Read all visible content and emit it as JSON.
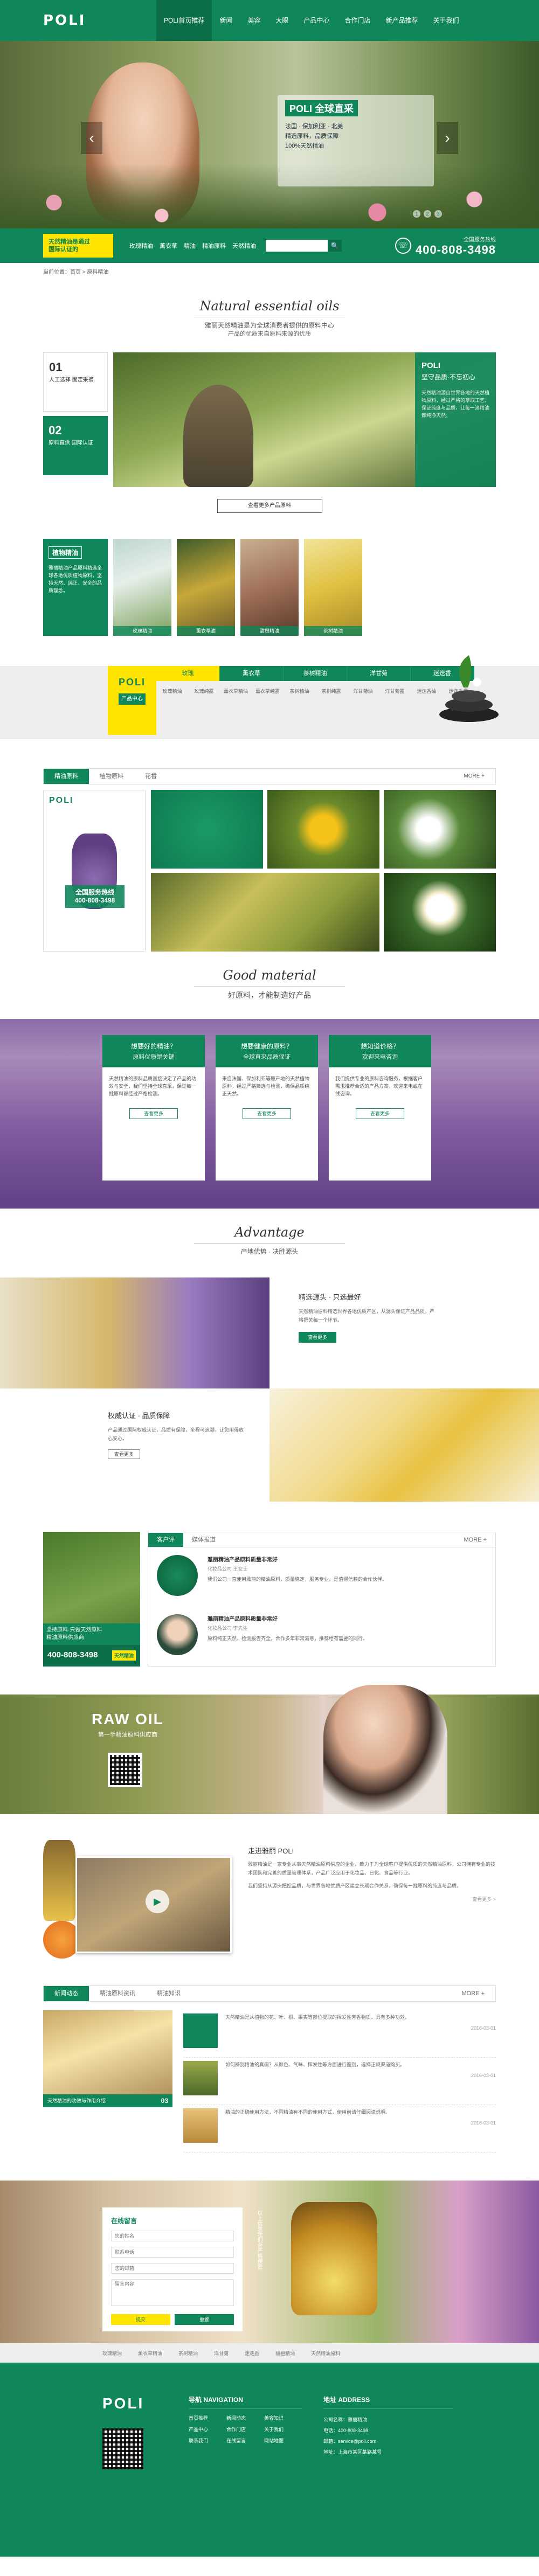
{
  "nav": {
    "logo": "POLI",
    "items": [
      "POLI首页推荐",
      "新闻",
      "美容",
      "大眼",
      "产品中心",
      "合作门店",
      "新产品推荐",
      "关于我们"
    ]
  },
  "hero": {
    "brand": "POLI 全球直采",
    "lines": [
      "法国 · 保加利亚 · 北美",
      "精选原料，品质保障",
      "100%天然精油"
    ],
    "arrow_left": "‹",
    "arrow_right": "›",
    "dots": [
      "1",
      "2",
      "3"
    ]
  },
  "search": {
    "badge": "天然精油是通过",
    "badge2": "国际认证的",
    "hot": [
      "玫瑰精油",
      "薰衣草",
      "精油",
      "精油原料",
      "天然精油"
    ],
    "placeholder": "",
    "button": "🔍",
    "phone_label": "全国服务热线",
    "phone": "400-808-3498"
  },
  "crumb": "当前位置：首页 > 原料精油",
  "s1": {
    "script": "Natural essential oils",
    "sub": "雅丽天然精油是为全球消费者提供的原料中心",
    "desc": "产品的优质来自原料来源的优质",
    "box1_num": "01",
    "box1_text": "人工选择 固定采摘",
    "box2_num": "02",
    "box2_text": "原料直供 国际认证",
    "gcard_title": "POLI",
    "gcard_title2": "坚守品质·不忘初心",
    "gcard_desc": "天然精油源自世界各地的天然植物原料，经过严格的萃取工艺，保证纯度与品质，让每一滴精油都纯净天然。",
    "btn": "查看更多产品原料",
    "row2_title": "植物精油",
    "row2_desc": "雅丽精油产品原料精选全球各地优质植物原料，坚持天然、纯正、安全的品质理念。",
    "labels": [
      "玫瑰精油",
      "薰衣草油",
      "甜橙精油",
      "茶树精油"
    ]
  },
  "cat": {
    "logo": "POLI",
    "logo_sub": "产品中心",
    "cols": [
      {
        "h": "玫瑰",
        "items": [
          "玫瑰精油",
          "玫瑰纯露"
        ]
      },
      {
        "h": "薰衣草",
        "items": [
          "薰衣草精油",
          "薰衣草纯露"
        ]
      },
      {
        "h": "茶树精油",
        "items": [
          "茶树精油",
          "茶树纯露"
        ]
      },
      {
        "h": "洋甘菊",
        "items": [
          "洋甘菊油",
          "洋甘菊露"
        ]
      },
      {
        "h": "迷迭香",
        "items": [
          "迷迭香油",
          "迷迭香露"
        ]
      }
    ]
  },
  "gallery": {
    "tabs": [
      "精油原料",
      "植物原料",
      "花香"
    ],
    "more": "MORE +",
    "tag": "全国服务热线\n400-808-3498",
    "logo": "POLI"
  },
  "good": {
    "script": "Good material",
    "sub": "好原料，才能制造好产品",
    "cards": [
      {
        "h": "想要好的精油？",
        "q": "原料优质是关键",
        "p": "天然精油的原料品质直接决定了产品的功效与安全，我们坚持全球直采，保证每一批原料都经过严格检测。",
        "btn": "查看更多"
      },
      {
        "h": "想要健康的原料？",
        "q": "全球直采品质保证",
        "p": "来自法国、保加利亚等原产地的天然植物原料，经过严格筛选与检测，确保品质纯正天然。",
        "btn": "查看更多"
      },
      {
        "h": "想知道价格？",
        "q": "欢迎来电咨询",
        "p": "我们提供专业的原料咨询服务，根据客户需求推荐合适的产品方案，欢迎来电或在线咨询。",
        "btn": "查看更多"
      }
    ]
  },
  "adv": {
    "script": "Advantage",
    "sub": "产地优势 · 决胜源头",
    "b1_h": "精选源头 · 只选最好",
    "b1_p": "天然精油原料精选世界各地优质产区，从源头保证产品品质，严格把关每一个环节。",
    "b1_btn": "查看更多",
    "b2_h": "权威认证 · 品质保障",
    "b2_p": "产品通过国际权威认证，品质有保障，全程可追溯，让您用得放心安心。",
    "b2_btn": "查看更多"
  },
  "test": {
    "tabs": [
      "客户评",
      "媒体报道"
    ],
    "more": "MORE +",
    "left_text": "坚持原料·只做天然原料\n精油原料供应商",
    "left_phone": "400-808-3498",
    "left_badge": "天然精油",
    "items": [
      {
        "t": "雅丽精油产品原料质量非常好",
        "s": "化妆品公司 王女士",
        "p": "我们公司一直使用雅丽的精油原料，质量稳定，服务专业，是值得信赖的合作伙伴。"
      },
      {
        "t": "雅丽精油产品原料质量非常好",
        "s": "化妆品公司 李先生",
        "p": "原料纯正天然，检测报告齐全，合作多年非常满意，推荐给有需要的同行。"
      }
    ]
  },
  "raw": {
    "a": "RAW OIL",
    "b": "第一手精油原料供应商"
  },
  "about": {
    "h": "走进雅丽 POLI",
    "p1": "雅丽精油是一家专业从事天然精油原料供应的企业，致力于为全球客户提供优质的天然精油原料。公司拥有专业的技术团队和完善的质量管理体系，产品广泛应用于化妆品、日化、食品等行业。",
    "p2": "我们坚持从源头把控品质，与世界各地优质产区建立长期合作关系，确保每一批原料的纯度与品质。",
    "more": "查看更多 >"
  },
  "news": {
    "tabs": [
      "新闻动态",
      "精油原料资讯",
      "精油知识"
    ],
    "more": "MORE +",
    "feat": "天然精油的功效与作用介绍",
    "feat_date": "03",
    "items": [
      {
        "p": "天然精油是从植物的花、叶、根、果实等部位提取的挥发性芳香物质，具有多种功效。",
        "d": "2016-03-01"
      },
      {
        "p": "如何辨别精油的真假？从颜色、气味、挥发性等方面进行鉴别，选择正规渠道购买。",
        "d": "2016-03-01"
      },
      {
        "p": "精油的正确使用方法，不同精油有不同的使用方式，使用前请仔细阅读说明。",
        "d": "2016-03-01"
      }
    ]
  },
  "form": {
    "h": "在线留言",
    "fields": [
      "您的姓名",
      "联系电话",
      "您的邮箱",
      "留言内容"
    ],
    "btn1": "提交",
    "btn2": "重置",
    "note": "以上信息我们会严格保密"
  },
  "links": [
    "玫瑰精油",
    "薰衣草精油",
    "茶树精油",
    "洋甘菊",
    "迷迭香",
    "甜橙精油",
    "天然精油原料"
  ],
  "footer": {
    "logo": "POLI",
    "nav_h": "导航 NAVIGATION",
    "nav": [
      "首页推荐",
      "新闻动态",
      "美容知识",
      "产品中心",
      "合作门店",
      "关于我们",
      "联系我们",
      "在线留言",
      "网站地图"
    ],
    "addr_h": "地址 ADDRESS",
    "addr": [
      "公司名称：雅丽精油",
      "电话：400-808-3498",
      "邮箱：service@poli.com",
      "地址：上海市某区某路某号"
    ]
  },
  "colors": {
    "green": "#10875a",
    "yellow": "#ffe400"
  }
}
